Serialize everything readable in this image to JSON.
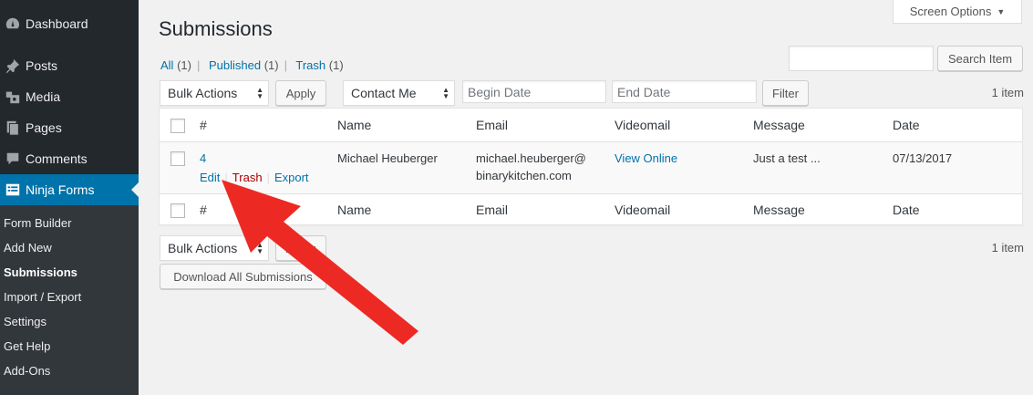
{
  "sidebar": {
    "top_items": [
      {
        "label": "Dashboard",
        "icon": "dashboard-icon"
      },
      {
        "label": "Posts",
        "icon": "pushpin-icon"
      },
      {
        "label": "Media",
        "icon": "media-icon"
      },
      {
        "label": "Pages",
        "icon": "pages-icon"
      },
      {
        "label": "Comments",
        "icon": "comment-icon"
      },
      {
        "label": "Ninja Forms",
        "icon": "forms-icon"
      }
    ],
    "submenu": [
      "Form Builder",
      "Add New",
      "Submissions",
      "Import / Export",
      "Settings",
      "Get Help",
      "Add-Ons"
    ]
  },
  "header": {
    "screen_options": "Screen Options",
    "title": "Submissions"
  },
  "views": [
    {
      "label": "All",
      "count": "(1)"
    },
    {
      "label": "Published",
      "count": "(1)"
    },
    {
      "label": "Trash",
      "count": "(1)"
    }
  ],
  "search": {
    "value": "",
    "button": "Search Item"
  },
  "top_nav": {
    "bulk_actions": "Bulk Actions",
    "apply": "Apply",
    "form_select": "Contact Me",
    "begin_date_placeholder": "Begin Date",
    "end_date_placeholder": "End Date",
    "filter": "Filter",
    "items_count": "1 item"
  },
  "table": {
    "columns": [
      "#",
      "Name",
      "Email",
      "Videomail",
      "Message",
      "Date"
    ],
    "row": {
      "id": "4",
      "name": "Michael Heuberger",
      "email_line1": "michael.heuberger@",
      "email_line2": "binarykitchen.com",
      "videomail": "View Online",
      "message": "Just a test ...",
      "date": "07/13/2017",
      "actions": {
        "edit": "Edit",
        "trash": "Trash",
        "export": "Export"
      }
    }
  },
  "bottom_nav": {
    "bulk_actions": "Bulk Actions",
    "apply": "Apply",
    "items_count": "1 item",
    "download_all": "Download All Submissions"
  },
  "colors": {
    "sidebar_bg": "#23282d",
    "accent": "#0073aa",
    "arrow": "#ec2a23"
  }
}
